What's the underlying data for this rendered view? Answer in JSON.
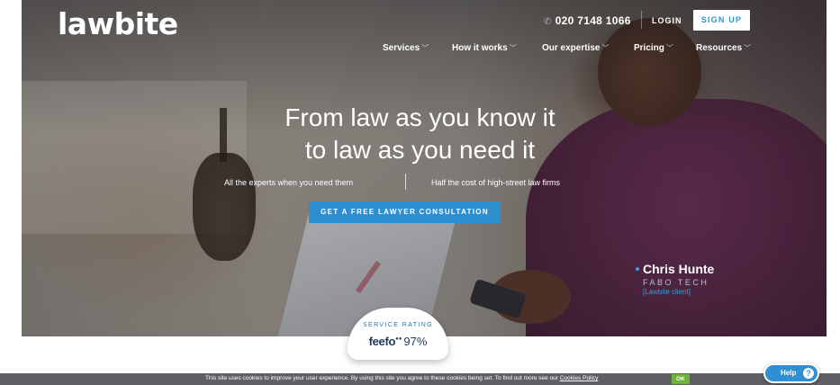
{
  "brand": {
    "logo_text": "lawbite"
  },
  "header": {
    "phone": "020 7148 1066",
    "login_label": "LOGIN",
    "signup_label": "SIGN UP"
  },
  "nav": {
    "items": [
      {
        "label": "Services"
      },
      {
        "label": "How it works"
      },
      {
        "label": "Our expertise"
      },
      {
        "label": "Pricing"
      },
      {
        "label": "Resources"
      }
    ]
  },
  "hero": {
    "headline_line1": "From law as you know it",
    "headline_line2": "to law as you need it",
    "benefit_left": "All the experts when you need them",
    "benefit_right": "Half the cost of high-street law firms",
    "cta_label": "GET A FREE LAWYER CONSULTATION"
  },
  "testimonial": {
    "name": "Chris Hunte",
    "company": "FABO TECH",
    "note": "[Lawbite client]"
  },
  "rating": {
    "label": "SERVICE RATING",
    "provider": "feefo",
    "value": "97%"
  },
  "cookie": {
    "text": "This site uses cookies to improve your user experience. By using this site you agree to these cookies being set. To find out more see our ",
    "link_label": "Cookies Policy",
    "ok_label": "OK"
  },
  "help": {
    "label": "Help"
  },
  "colors": {
    "accent_blue": "#2e8fd0",
    "cookie_ok_green": "#6fb33b",
    "cookie_bar": "#5e6063"
  },
  "icons": {
    "phone": "phone-icon",
    "chevron": "chevron-down-icon",
    "help": "question-icon"
  }
}
